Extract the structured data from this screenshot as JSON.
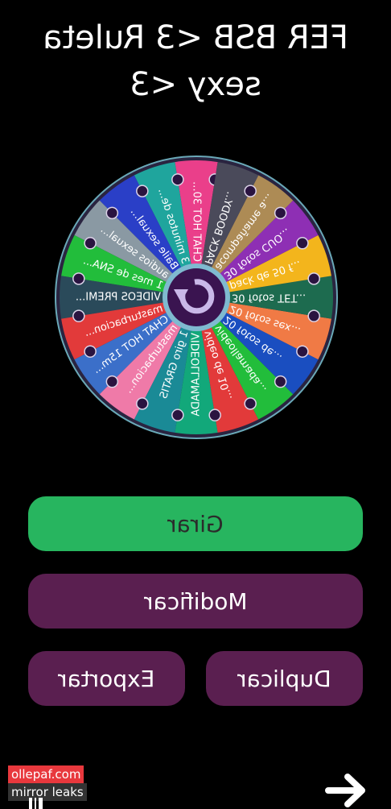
{
  "title": "FER BSB <3 Ruleta sexy <3",
  "wheel": {
    "segments": [
      {
        "label": "CHAT HOT 30...",
        "color": "#ea3f8a"
      },
      {
        "label": "3 minutos de...",
        "color": "#1fa59d"
      },
      {
        "label": "Baile sexual...",
        "color": "#2a3fc7"
      },
      {
        "label": "audios sexual...",
        "color": "#8a99a3"
      },
      {
        "label": "1 mes de SNA...",
        "color": "#22bd3b"
      },
      {
        "label": "VIDEOS PREMI...",
        "color": "#2a4a5a"
      },
      {
        "label": "masturbacion...",
        "color": "#e23a3a"
      },
      {
        "label": "CHAT HOT 15m...",
        "color": "#3b6fc9"
      },
      {
        "label": "masturbacion...",
        "color": "#ef7aa8"
      },
      {
        "label": "1 giro GRATIS",
        "color": "#1a8a96"
      },
      {
        "label": "VIDEOLLAMADA",
        "color": "#12a87a"
      },
      {
        "label": "video de 10...",
        "color": "#e23a3a"
      },
      {
        "label": "videollamada...",
        "color": "#22bd3b"
      },
      {
        "label": "20 fotos de...",
        "color": "#1a4ec0"
      },
      {
        "label": "20 fotos sex...",
        "color": "#f07a45"
      },
      {
        "label": "30 fotos TET...",
        "color": "#1d6b4f"
      },
      {
        "label": "pack de 50 f...",
        "color": "#f3b51c"
      },
      {
        "label": "30 fotos CUO...",
        "color": "#8e2fb4"
      },
      {
        "label": "acompañame a...",
        "color": "#ad8b55"
      },
      {
        "label": "PACK BOODY...",
        "color": "#4a4a5a"
      }
    ],
    "center_icon": "refresh-icon"
  },
  "buttons": {
    "spin": "Girar",
    "modify": "Modificar",
    "duplicate": "Duplicar",
    "export": "Exportar"
  },
  "watermark": {
    "line1": "ollepaf.com",
    "line2": "mirror leaks"
  },
  "icons": {
    "next": "arrow-right-icon"
  }
}
